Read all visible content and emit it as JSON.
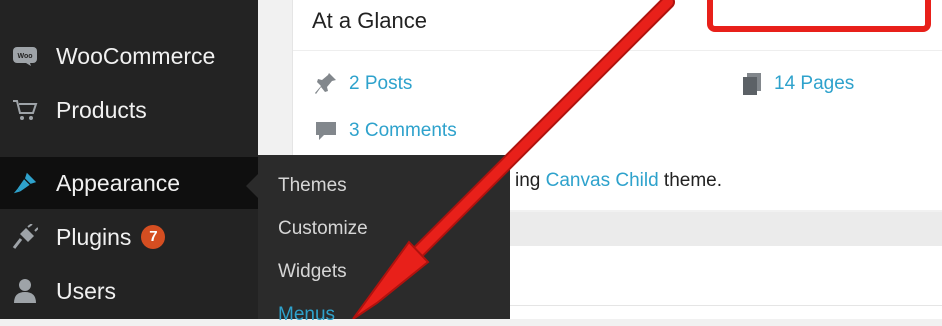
{
  "sidebar": {
    "items": [
      {
        "label": "WooCommerce",
        "icon": "woo-icon"
      },
      {
        "label": "Products",
        "icon": "cart-icon"
      },
      {
        "label": "Appearance",
        "icon": "brush-icon",
        "active": true
      },
      {
        "label": "Plugins",
        "icon": "plug-icon",
        "badge": "7"
      },
      {
        "label": "Users",
        "icon": "user-icon"
      }
    ],
    "submenu": [
      "Themes",
      "Customize",
      "Widgets",
      "Menus"
    ],
    "current_submenu": "Menus"
  },
  "dashboard": {
    "card_title": "At a Glance",
    "posts": "2 Posts",
    "pages": "14 Pages",
    "comments": "3 Comments",
    "theme_prefix": "ing ",
    "theme_name": "Canvas Child",
    "theme_suffix": " theme."
  },
  "colors": {
    "sidebar_bg": "#232323",
    "submenu_bg": "#2b2b2b",
    "link": "#2ea2cc",
    "badge": "#d54e21",
    "annotation_red": "#e8201a"
  }
}
